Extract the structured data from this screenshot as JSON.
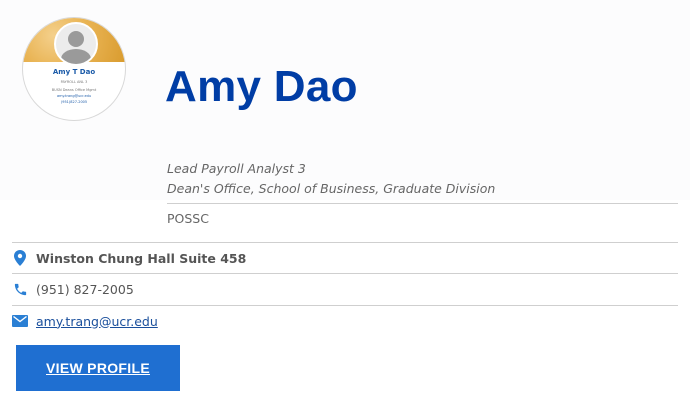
{
  "profile": {
    "name": "Amy Dao",
    "title": "Lead Payroll Analyst 3",
    "department": "Dean's Office, School of Business, Graduate Division",
    "org_unit": "POSSC",
    "location": "Winston Chung Hall Suite 458",
    "phone": "(951) 827-2005",
    "email": "amy.trang@ucr.edu",
    "view_profile_label": "VIEW PROFILE"
  },
  "avatar_card": {
    "name": "Amy T Dao",
    "line1": "PAYROLL ANL 3",
    "line2": "BUSN Deans Office Mgmt",
    "line3": "amy.trang@ucr.edu",
    "line4": "(951)827-2005"
  },
  "icons": {
    "location": "location-pin-icon",
    "phone": "phone-icon",
    "email": "envelope-icon"
  },
  "colors": {
    "name": "#003da5",
    "button": "#1f6fd1",
    "icon": "#2a7fd4"
  }
}
